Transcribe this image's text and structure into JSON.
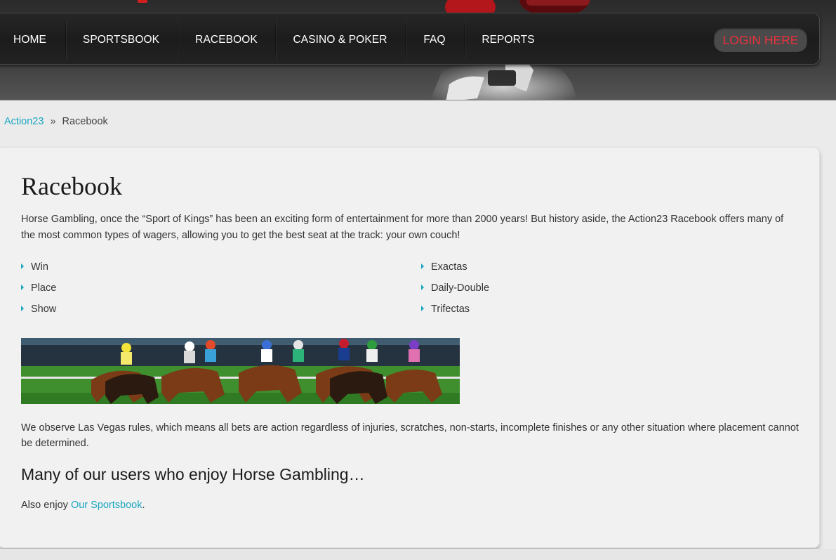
{
  "colors": {
    "accent": "#1ba7c0",
    "login_text": "#e8323c",
    "nav_bg": "#1f1f1f"
  },
  "nav": {
    "items": [
      {
        "label": "HOME"
      },
      {
        "label": "SPORTSBOOK"
      },
      {
        "label": "RACEBOOK"
      },
      {
        "label": "CASINO & POKER"
      },
      {
        "label": "FAQ"
      },
      {
        "label": "REPORTS"
      }
    ],
    "login_label": "LOGIN HERE"
  },
  "breadcrumb": {
    "home": "Action23",
    "separator": "»",
    "current": "Racebook"
  },
  "content": {
    "title": "Racebook",
    "intro": "Horse Gambling, once the “Sport of Kings” has been an exciting form of entertainment for more than 2000 years! But history aside, the Action23 Racebook offers many of the most common types of wagers, allowing you to get the best seat at the track: your own couch!",
    "wagers_left": [
      "Win",
      "Place",
      "Show"
    ],
    "wagers_right": [
      "Exactas",
      "Daily-Double",
      "Trifectas"
    ],
    "rules": "We observe Las Vegas rules, which means all bets are action regardless of injuries, scratches, non-starts, incomplete finishes or any other situation where placement cannot be determined.",
    "subheading": "Many of our users who enjoy Horse Gambling…",
    "also_prefix": "Also enjoy ",
    "also_link": "Our Sportsbook",
    "also_suffix": "."
  }
}
